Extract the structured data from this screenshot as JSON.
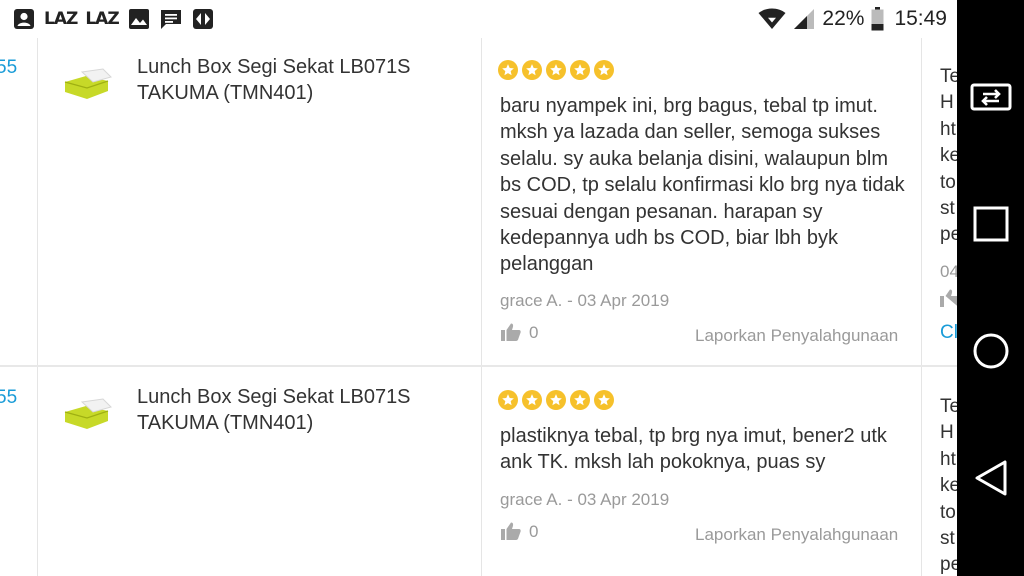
{
  "status_bar": {
    "left_icons": [
      "person-icon",
      "laz-icon",
      "laz-icon",
      "image-icon",
      "message-icon",
      "app-icon"
    ],
    "laz_text": "LAZ",
    "battery_percent": "22%",
    "time": "15:49"
  },
  "reviews": [
    {
      "left_partial": "55",
      "product_name": "Lunch Box Segi Sekat LB071S TAKUMA (TMN401)",
      "rating": 5,
      "text": "baru nyampek ini, brg bagus, tebal tp imut. mksh ya lazada dan seller, semoga sukses selalu. sy auka belanja disini, walaupun blm bs COD, tp selalu konfirmasi klo brg nya tidak sesuai dengan pesanan. harapan sy kedepannya udh bs COD, biar lbh byk pelanggan",
      "author_date": "grace A. - 03 Apr 2019",
      "likes": "0",
      "report_label": "Laporkan Penyalahgunaan",
      "right_partial": [
        "Te",
        "H",
        "ht",
        "ke",
        "to",
        "st",
        "pe"
      ],
      "right_partial_date": "04",
      "right_partial_link": "Cl"
    },
    {
      "left_partial": "55",
      "product_name": "Lunch Box Segi Sekat LB071S TAKUMA (TMN401)",
      "rating": 5,
      "text": "plastiknya tebal, tp brg nya imut, bener2 utk ank TK. mksh lah pokoknya, puas sy",
      "author_date": "grace A. - 03 Apr 2019",
      "likes": "0",
      "report_label": "Laporkan Penyalahgunaan",
      "right_partial": [
        "Te",
        "H",
        "ht",
        "ke",
        "to",
        "st",
        "pe"
      ]
    }
  ],
  "nav_bar": {
    "buttons": [
      "screen-cast-icon",
      "recents-icon",
      "home-icon",
      "back-icon"
    ]
  },
  "colors": {
    "star": "#f6c12b",
    "link_blue": "#1a9cd8",
    "muted_text": "#9a9a9a",
    "nav_background": "#000000"
  }
}
